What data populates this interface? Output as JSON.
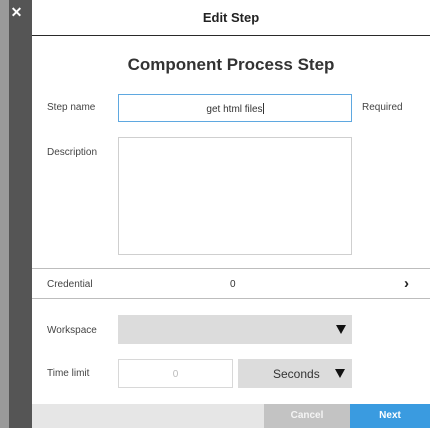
{
  "header": {
    "title": "Edit Step"
  },
  "section": {
    "title": "Component Process Step"
  },
  "form": {
    "step_name": {
      "label": "Step name",
      "value": "get html files",
      "required_label": "Required"
    },
    "description": {
      "label": "Description",
      "value": ""
    },
    "credential": {
      "label": "Credential",
      "value": "0"
    },
    "workspace": {
      "label": "Workspace",
      "selected": ""
    },
    "time_limit": {
      "label": "Time limit",
      "placeholder": "0",
      "unit": "Seconds"
    }
  },
  "footer": {
    "cancel_label": "Cancel",
    "next_label": "Next"
  },
  "colors": {
    "accent": "#3a9be0",
    "focus_border": "#5fa8e0",
    "disabled": "#c3c3c3"
  },
  "icons": [
    "close-icon",
    "chevron-right-icon",
    "chevron-down-icon"
  ]
}
